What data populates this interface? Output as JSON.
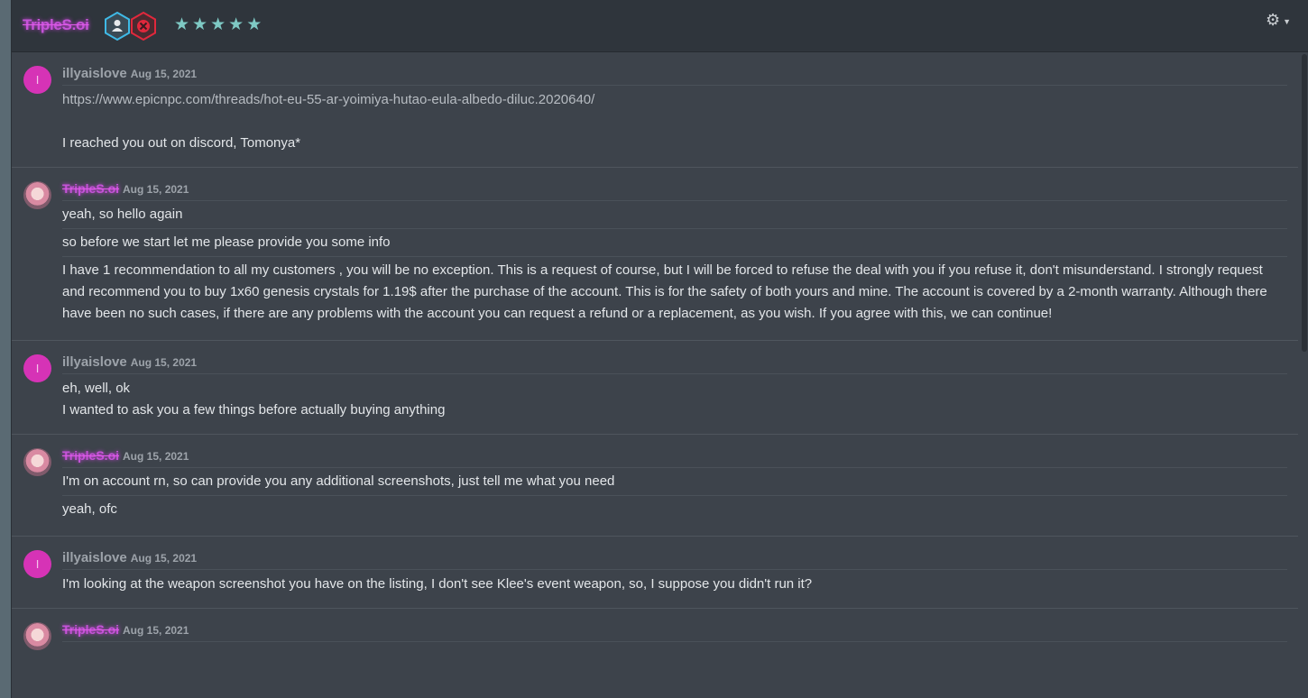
{
  "header": {
    "name": "TripleS.oi",
    "stars": [
      "★",
      "★",
      "★",
      "★",
      "★"
    ]
  },
  "messages": [
    {
      "author": "illyaislove",
      "avatar_letter": "I",
      "date": "Aug 15, 2021",
      "lines": [
        "https://www.epicnpc.com/threads/hot-eu-55-ar-yoimiya-hutao-eula-albedo-diluc.2020640/",
        "I reached you out on discord, Tomonya*"
      ]
    },
    {
      "author": "TripleS.oi",
      "date": "Aug 15, 2021",
      "lines": [
        "yeah, so hello again",
        "so before we start let me please provide you some info",
        "I have 1 recommendation to all my customers , you will be no exception. This is a request of course, but I will be forced to refuse the deal with you if you refuse it, don't misunderstand. I strongly request and recommend you to buy 1x60 genesis crystals for 1.19$ after the purchase of the account. This is for the safety of both yours and mine. The account is covered by a 2-month warranty. Although there have been no such cases, if there are any problems with the account you can request a refund or a replacement, as you wish. If you agree with this, we can continue!"
      ]
    },
    {
      "author": "illyaislove",
      "avatar_letter": "I",
      "date": "Aug 15, 2021",
      "lines": [
        "eh, well, ok",
        "I wanted to ask you a few things before actually buying anything"
      ]
    },
    {
      "author": "TripleS.oi",
      "date": "Aug 15, 2021",
      "lines": [
        "I'm on account rn, so can provide you any additional screenshots, just tell me what you need",
        "yeah, ofc"
      ]
    },
    {
      "author": "illyaislove",
      "avatar_letter": "I",
      "date": "Aug 15, 2021",
      "lines": [
        "I'm looking at the weapon screenshot you have on the listing, I don't see Klee's event weapon, so, I suppose you didn't run it?"
      ]
    },
    {
      "author": "TripleS.oi",
      "date": "Aug 15, 2021",
      "lines": []
    }
  ]
}
